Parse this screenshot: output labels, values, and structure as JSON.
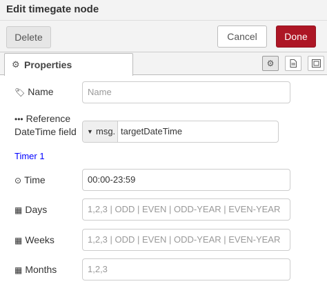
{
  "window": {
    "title": "Edit timegate node"
  },
  "toolbar": {
    "delete_label": "Delete",
    "cancel_label": "Cancel",
    "done_label": "Done"
  },
  "tabs": {
    "properties_label": "Properties"
  },
  "form": {
    "name": {
      "label": "Name",
      "placeholder": "Name",
      "value": ""
    },
    "reference": {
      "label_line1": "Reference",
      "label_line2": "DateTime field",
      "prefix": "msg.",
      "value": "targetDateTime"
    },
    "section_title": "Timer 1",
    "time": {
      "label": "Time",
      "value": "00:00-23:59"
    },
    "days": {
      "label": "Days",
      "placeholder": "1,2,3 | ODD | EVEN | ODD-YEAR | EVEN-YEAR"
    },
    "weeks": {
      "label": "Weeks",
      "placeholder": "1,2,3 | ODD | EVEN | ODD-YEAR | EVEN-YEAR"
    },
    "months": {
      "label": "Months",
      "placeholder": "1,2,3"
    }
  },
  "colors": {
    "done_button": "#ad1625",
    "section_title": "#0000ff"
  }
}
